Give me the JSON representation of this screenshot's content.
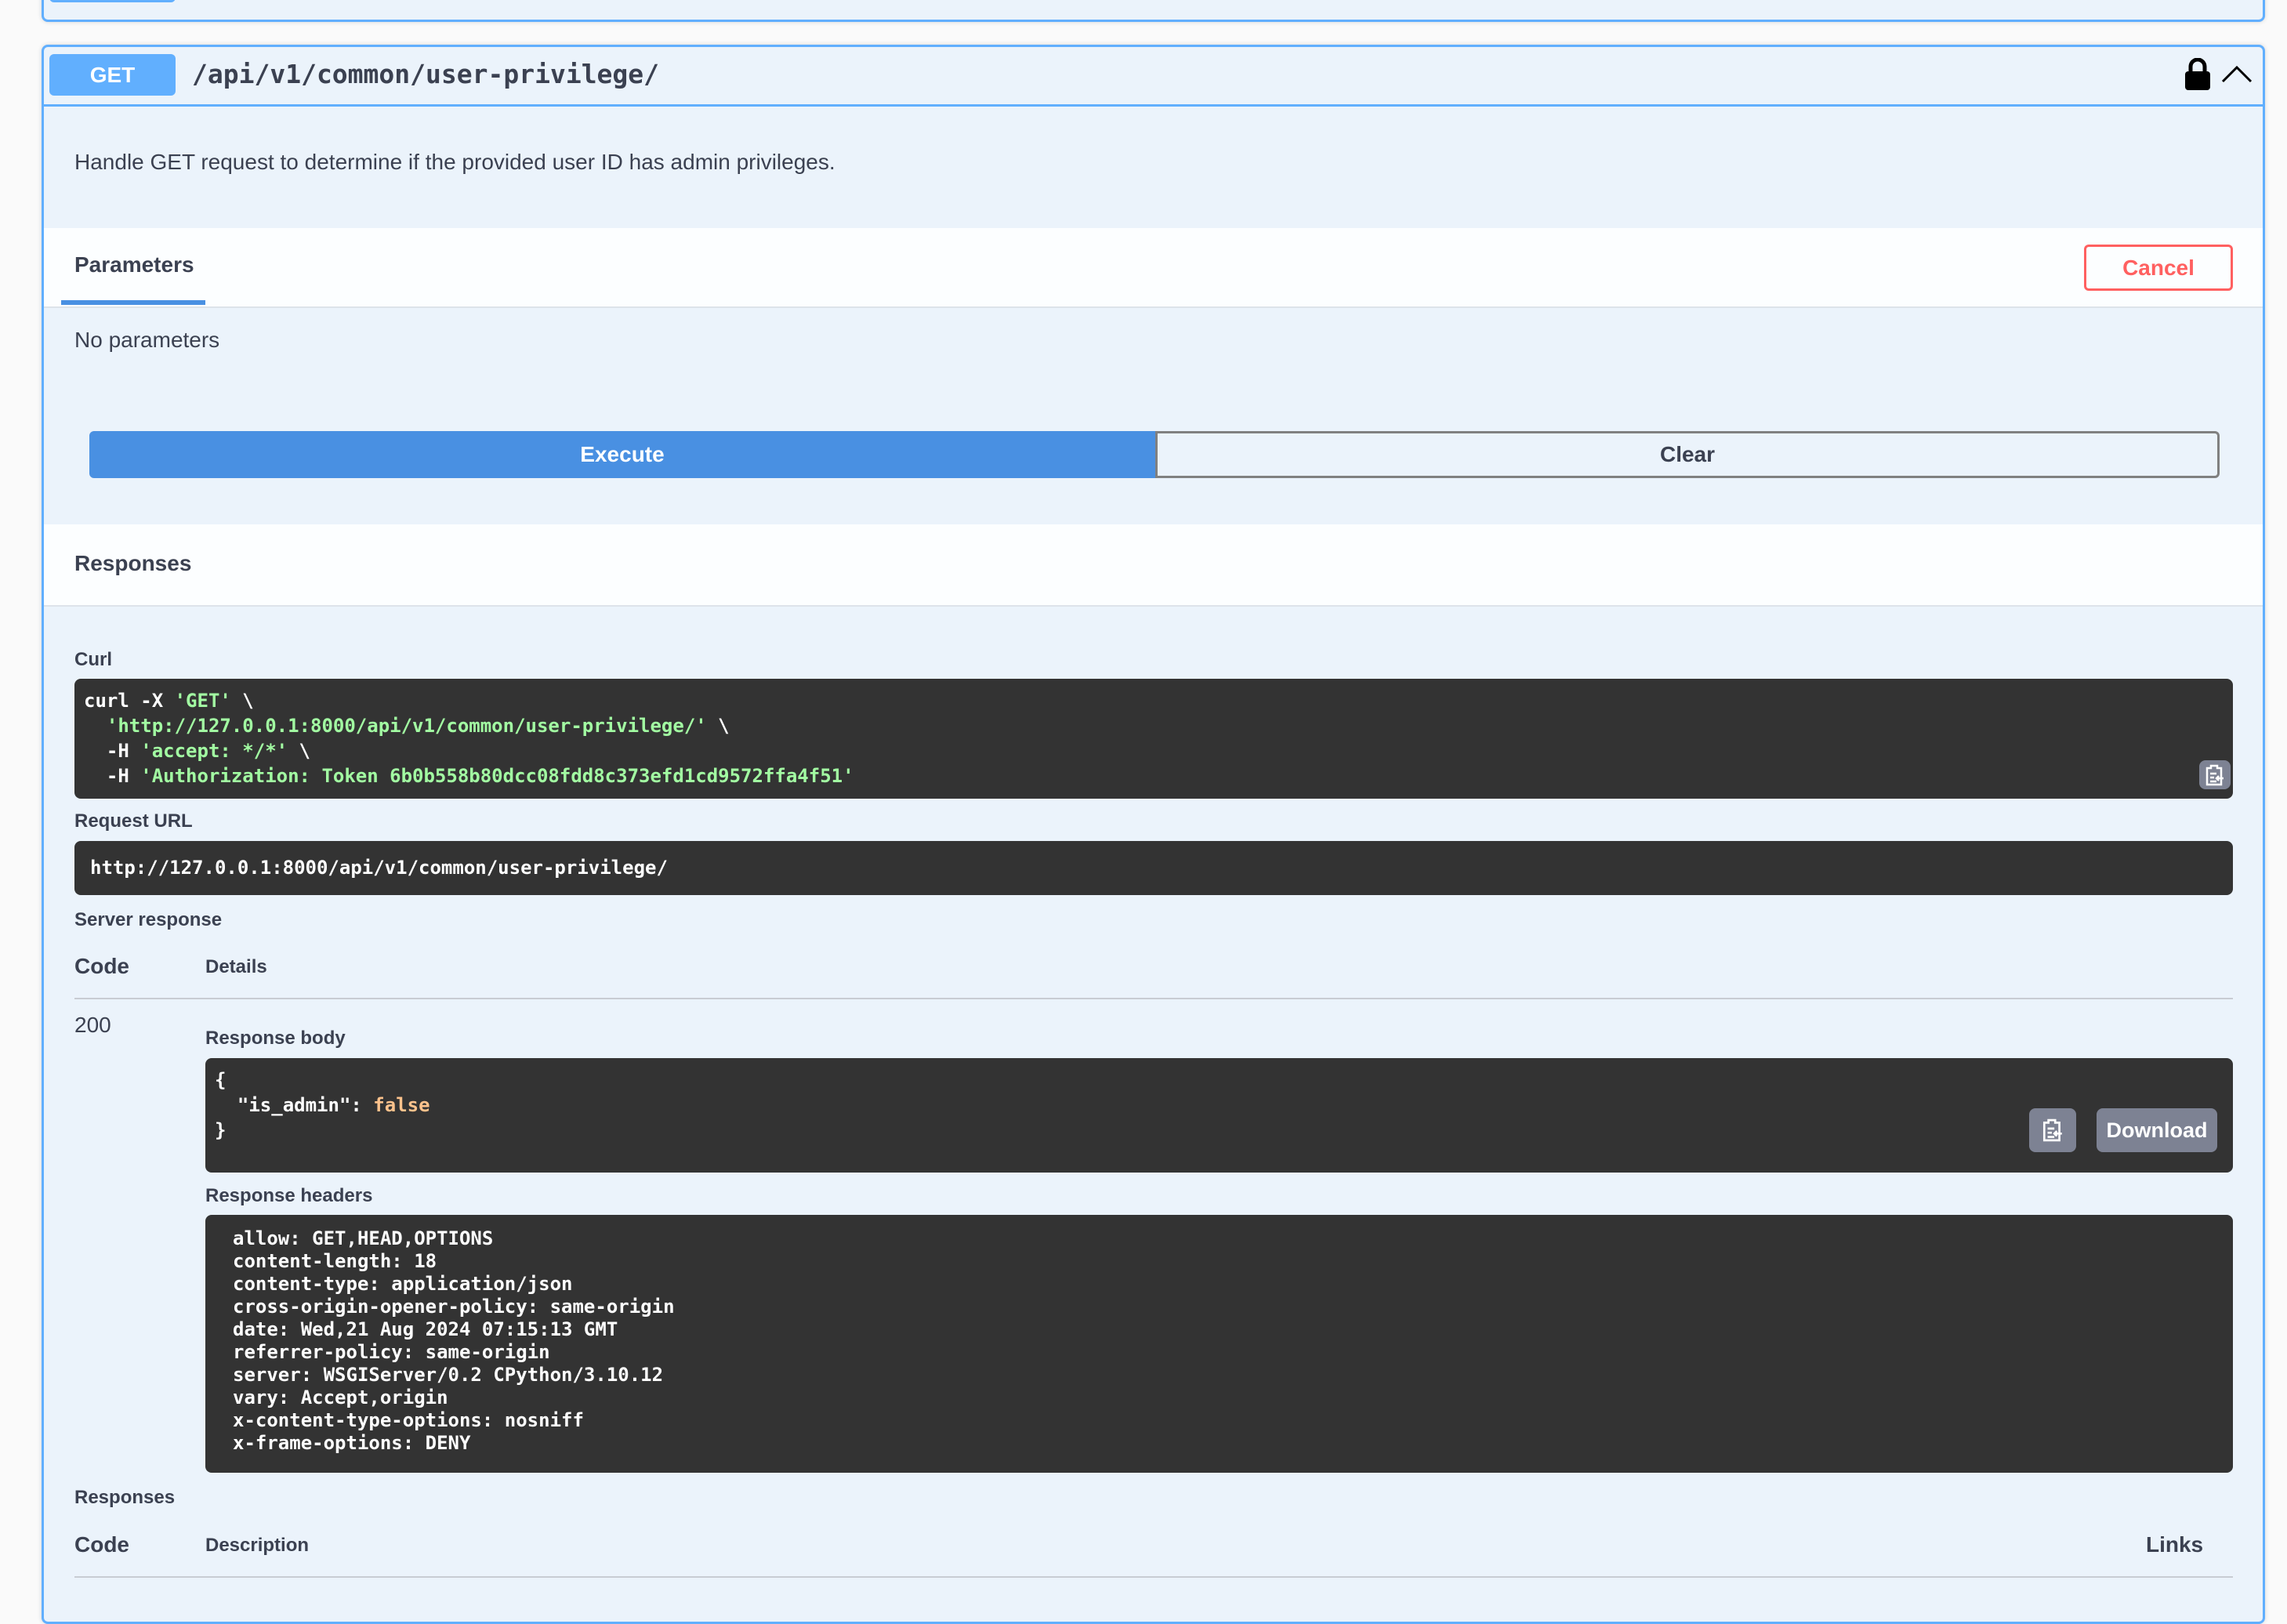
{
  "endpoint": {
    "method": "GET",
    "path": "/api/v1/common/user-privilege/",
    "description": "Handle GET request to determine if the provided user ID has admin privileges.",
    "colors": {
      "method": "#61affe",
      "border": "#61affe",
      "background": "#ebf3fb"
    }
  },
  "parameters": {
    "tab_label": "Parameters",
    "cancel_label": "Cancel",
    "empty_text": "No parameters"
  },
  "actions": {
    "execute_label": "Execute",
    "clear_label": "Clear"
  },
  "responses_section": {
    "title": "Responses"
  },
  "curl": {
    "label": "Curl",
    "lines": [
      {
        "plain": "curl -X ",
        "str": "'GET'",
        "tail": " \\"
      },
      {
        "plain": "  ",
        "str": "'http://127.0.0.1:8000/api/v1/common/user-privilege/'",
        "tail": " \\"
      },
      {
        "plain": "  -H ",
        "str": "'accept: */*'",
        "tail": " \\"
      },
      {
        "plain": "  -H ",
        "str": "'Authorization: Token 6b0b558b80dcc08fdd8c373efd1cd9572ffa4f51'",
        "tail": ""
      }
    ]
  },
  "request_url": {
    "label": "Request URL",
    "value": "http://127.0.0.1:8000/api/v1/common/user-privilege/"
  },
  "server_response": {
    "label": "Server response",
    "code_header": "Code",
    "details_header": "Details",
    "code": "200",
    "body_label": "Response body",
    "body": {
      "open": "{",
      "key": "  \"is_admin\": ",
      "value": "false",
      "close": "}"
    },
    "download_label": "Download",
    "headers_label": "Response headers",
    "headers": [
      "allow: GET,HEAD,OPTIONS",
      "content-length: 18",
      "content-type: application/json",
      "cross-origin-opener-policy: same-origin",
      "date: Wed,21 Aug 2024 07:15:13 GMT",
      "referrer-policy: same-origin",
      "server: WSGIServer/0.2 CPython/3.10.12",
      "vary: Accept,origin",
      "x-content-type-options: nosniff",
      "x-frame-options: DENY"
    ]
  },
  "responses": {
    "label": "Responses",
    "code_header": "Code",
    "description_header": "Description",
    "links_header": "Links"
  }
}
